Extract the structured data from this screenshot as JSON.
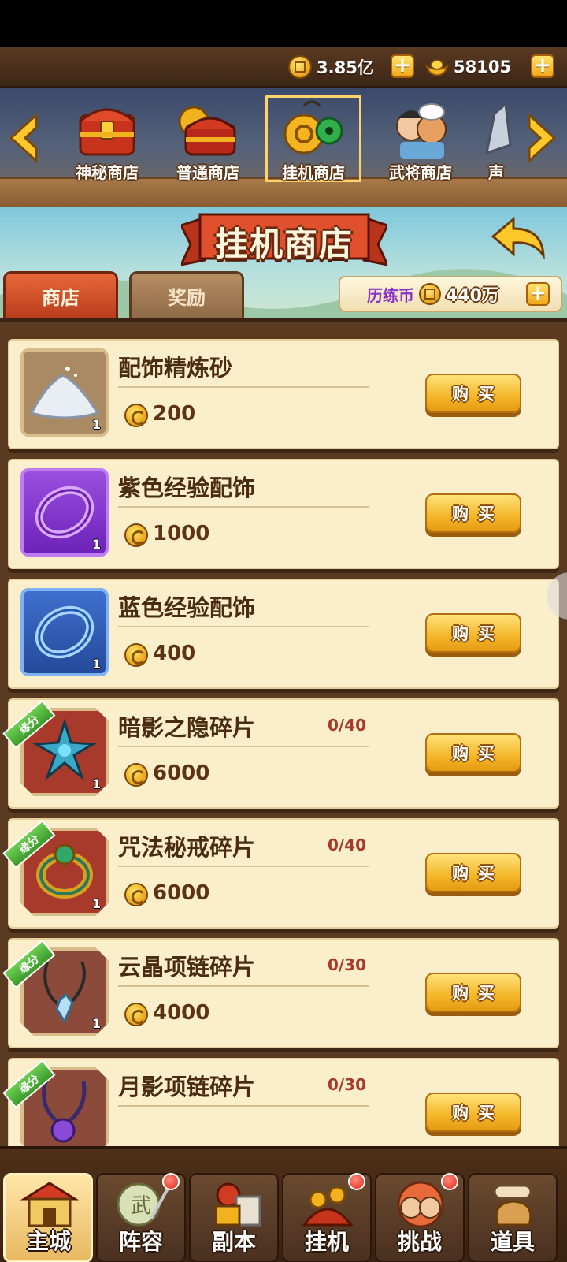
{
  "currency": {
    "coins": "3.85亿",
    "ingots": "58105"
  },
  "shop_tabs": [
    {
      "label": "神秘商店",
      "active": false
    },
    {
      "label": "普通商店",
      "active": false
    },
    {
      "label": "挂机商店",
      "active": true
    },
    {
      "label": "武将商店",
      "active": false
    },
    {
      "label": "声",
      "active": false
    }
  ],
  "page_title": "挂机商店",
  "subtabs": {
    "shop": "商店",
    "reward": "奖励"
  },
  "exp_coin": {
    "label": "历练币",
    "value": "440万"
  },
  "items": [
    {
      "name": "配饰精炼砂",
      "price": "200",
      "qty": "1",
      "count": "",
      "fate": "",
      "icon": "sand-icon"
    },
    {
      "name": "紫色经验配饰",
      "price": "1000",
      "qty": "1",
      "count": "",
      "fate": "",
      "icon": "purple-bracelet-icon"
    },
    {
      "name": "蓝色经验配饰",
      "price": "400",
      "qty": "1",
      "count": "",
      "fate": "",
      "icon": "blue-bracelet-icon"
    },
    {
      "name": "暗影之隐碎片",
      "price": "6000",
      "qty": "1",
      "count": "0/40",
      "fate": "缘分",
      "icon": "shadow-amulet-icon"
    },
    {
      "name": "咒法秘戒碎片",
      "price": "6000",
      "qty": "1",
      "count": "0/40",
      "fate": "缘分",
      "icon": "ring-icon"
    },
    {
      "name": "云晶项链碎片",
      "price": "4000",
      "qty": "1",
      "count": "0/30",
      "fate": "缘分",
      "icon": "crystal-necklace-icon"
    },
    {
      "name": "月影项链碎片",
      "price": "",
      "qty": "",
      "count": "0/30",
      "fate": "缘分",
      "icon": "moon-necklace-icon"
    }
  ],
  "buy_label": "购买",
  "nav": [
    {
      "label": "主城",
      "active": true,
      "dot": false
    },
    {
      "label": "阵容",
      "active": false,
      "dot": true
    },
    {
      "label": "副本",
      "active": false,
      "dot": false
    },
    {
      "label": "挂机",
      "active": false,
      "dot": true
    },
    {
      "label": "挑战",
      "active": false,
      "dot": true
    },
    {
      "label": "道具",
      "active": false,
      "dot": false
    }
  ],
  "colors": {
    "accent_gold": "#f3b628",
    "wood_dark": "#5b3a22",
    "card_bg": "#fbeecb",
    "count_red": "#a73b2a",
    "exp_purple": "#8a32c8"
  }
}
